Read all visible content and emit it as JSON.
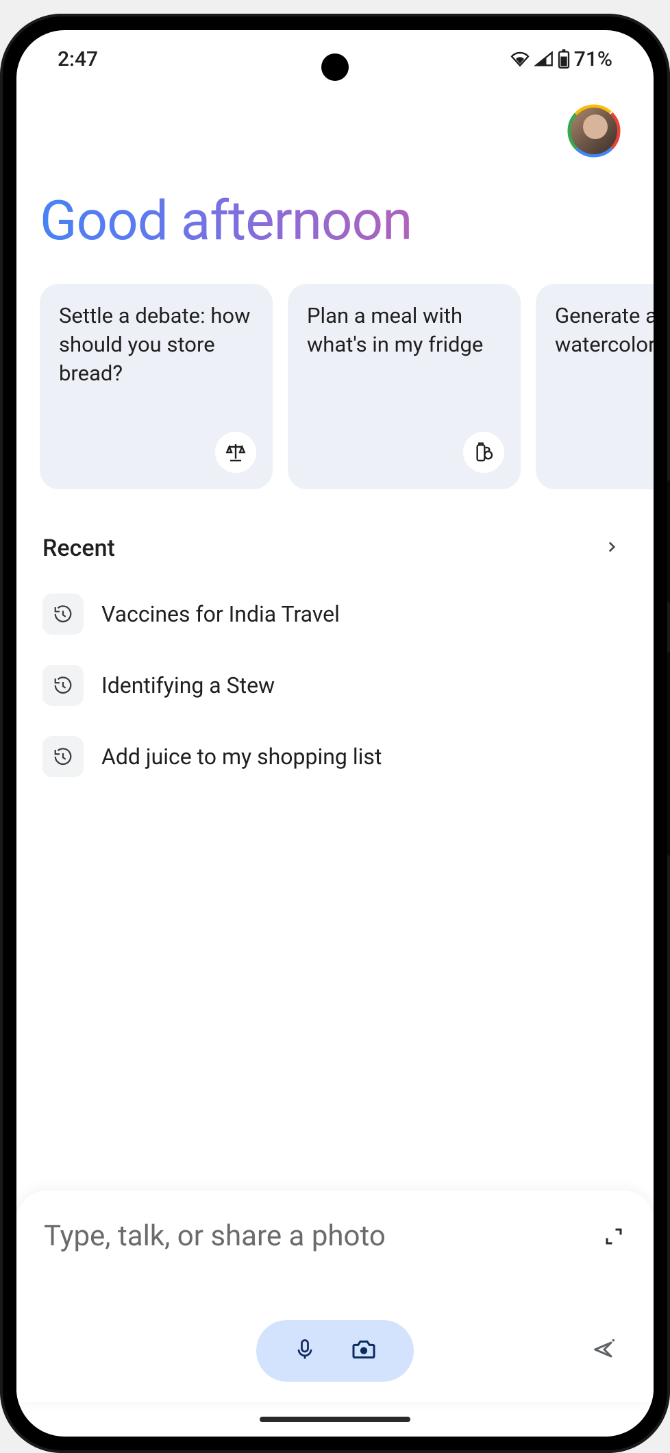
{
  "status_bar": {
    "time": "2:47",
    "battery_percent": "71%"
  },
  "greeting": "Good afternoon",
  "suggestions": [
    {
      "text": "Settle a debate: how should you store bread?",
      "icon": "scales-icon"
    },
    {
      "text": "Plan a meal with what's in my fridge",
      "icon": "bottle-icon"
    },
    {
      "text": "Generate a watercolor",
      "icon": ""
    }
  ],
  "recent": {
    "title": "Recent",
    "items": [
      "Vaccines for India Travel",
      "Identifying a Stew",
      "Add juice to my shopping list"
    ]
  },
  "input": {
    "placeholder": "Type, talk, or share a photo"
  }
}
